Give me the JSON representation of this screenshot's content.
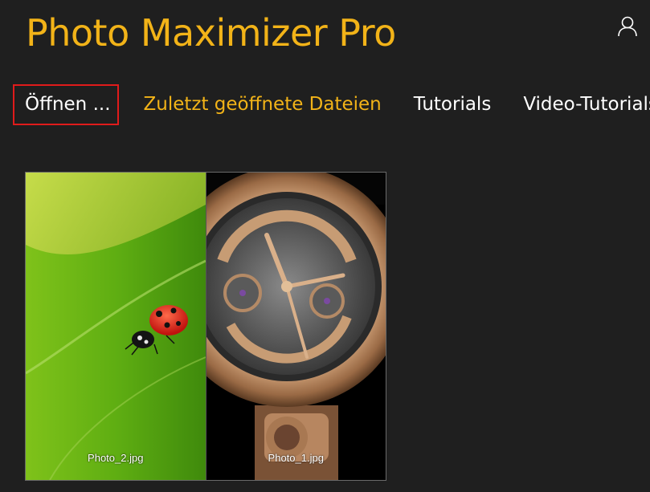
{
  "app": {
    "title": "Photo Maximizer Pro"
  },
  "header": {
    "user_icon": "user-icon"
  },
  "nav": {
    "items": [
      {
        "label": "Öffnen ..."
      },
      {
        "label": "Zuletzt geöffnete Dateien"
      },
      {
        "label": "Tutorials"
      },
      {
        "label": "Video-Tutorials"
      }
    ]
  },
  "gallery": {
    "items": [
      {
        "filename": "Photo_2.jpg"
      },
      {
        "filename": "Photo_1.jpg"
      }
    ]
  },
  "colors": {
    "background": "#1f1f1f",
    "accent": "#f2b318",
    "highlight_border": "#e01b1b",
    "text": "#ffffff"
  }
}
